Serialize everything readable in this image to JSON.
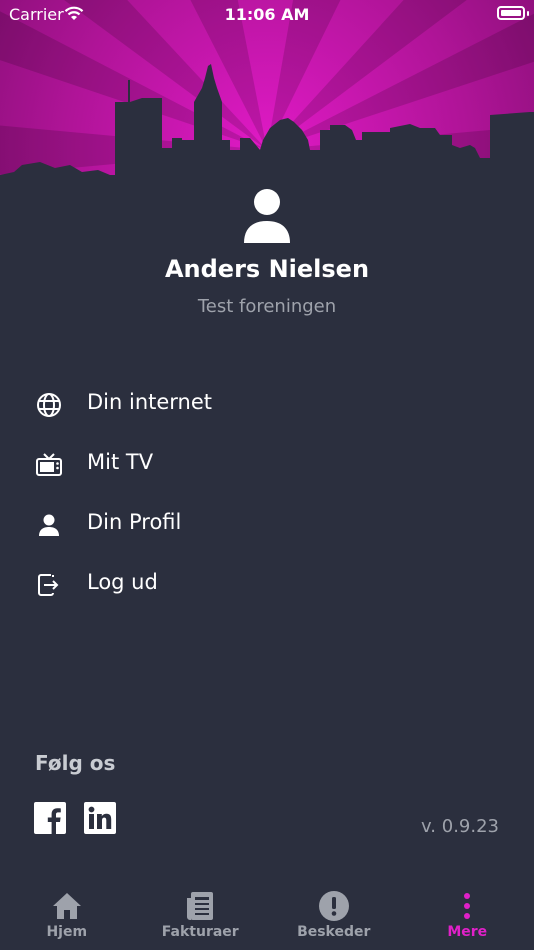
{
  "status_bar": {
    "carrier": "Carrier",
    "time": "11:06 AM"
  },
  "profile": {
    "name": "Anders Nielsen",
    "organization": "Test foreningen"
  },
  "menu": {
    "items": [
      {
        "label": "Din internet",
        "icon": "globe-icon"
      },
      {
        "label": "Mit TV",
        "icon": "tv-icon"
      },
      {
        "label": "Din Profil",
        "icon": "person-icon"
      },
      {
        "label": "Log ud",
        "icon": "logout-icon"
      }
    ]
  },
  "social": {
    "title": "Følg os",
    "networks": [
      "facebook-icon",
      "linkedin-icon"
    ]
  },
  "version": "v. 0.9.23",
  "tabs": [
    {
      "label": "Hjem",
      "icon": "home-icon",
      "active": false
    },
    {
      "label": "Fakturaer",
      "icon": "invoice-icon",
      "active": false
    },
    {
      "label": "Beskeder",
      "icon": "alert-icon",
      "active": false
    },
    {
      "label": "Mere",
      "icon": "more-icon",
      "active": true
    }
  ],
  "colors": {
    "accent": "#e020c8",
    "background": "#2b2f3e",
    "hero_magenta": "#c21aae",
    "muted_text": "#9ea2ab"
  }
}
